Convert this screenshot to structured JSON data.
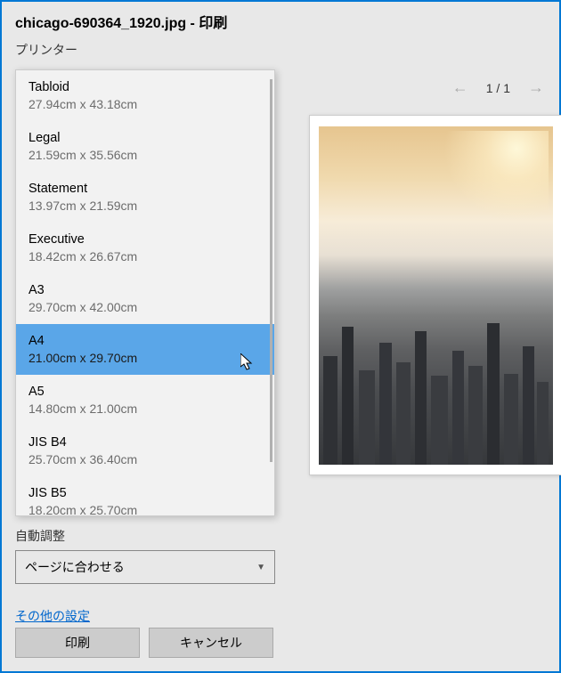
{
  "title": "chicago-690364_1920.jpg - 印刷",
  "printer_label": "プリンター",
  "paper_sizes": [
    {
      "name": "Tabloid",
      "dims": "27.94cm x 43.18cm"
    },
    {
      "name": "Legal",
      "dims": "21.59cm x 35.56cm"
    },
    {
      "name": "Statement",
      "dims": "13.97cm x 21.59cm"
    },
    {
      "name": "Executive",
      "dims": "18.42cm x 26.67cm"
    },
    {
      "name": "A3",
      "dims": "29.70cm x 42.00cm"
    },
    {
      "name": "A4",
      "dims": "21.00cm x 29.70cm"
    },
    {
      "name": "A5",
      "dims": "14.80cm x 21.00cm"
    },
    {
      "name": "JIS B4",
      "dims": "25.70cm x 36.40cm"
    },
    {
      "name": "JIS B5",
      "dims": "18.20cm x 25.70cm"
    }
  ],
  "selected_index": 5,
  "auto_adjust_label": "自動調整",
  "fit_option": "ページに合わせる",
  "more_settings": "その他の設定",
  "print_button": "印刷",
  "cancel_button": "キャンセル",
  "page_indicator": "1 / 1"
}
